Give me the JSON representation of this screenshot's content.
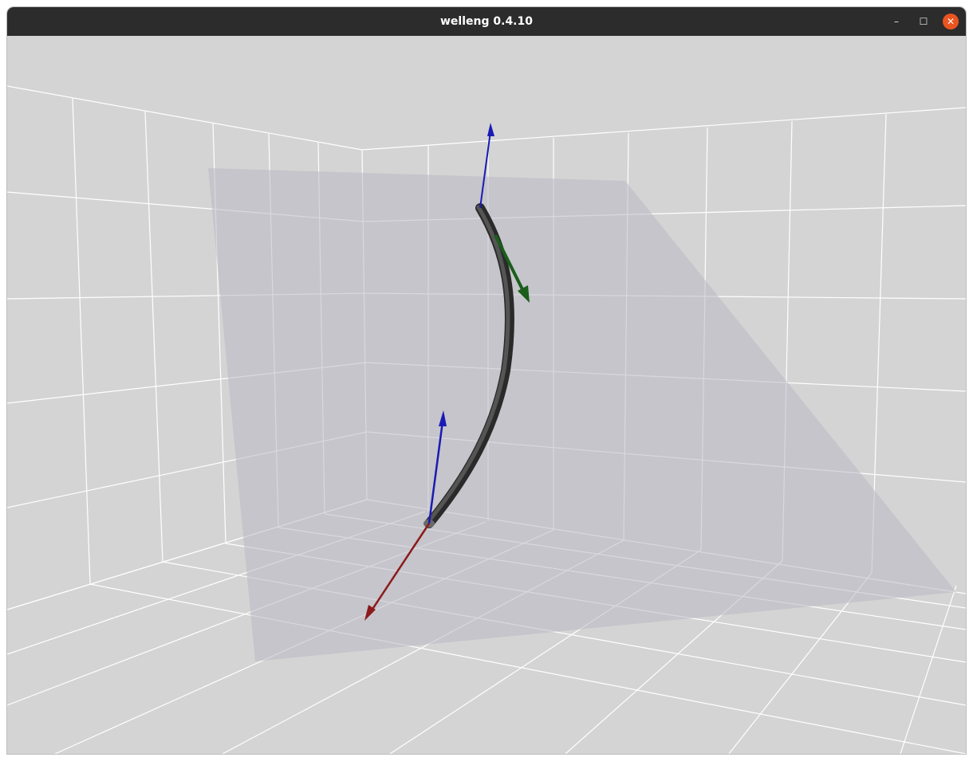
{
  "window": {
    "title": "welleng 0.4.10",
    "minimize_glyph": "–",
    "maximize_glyph": "☐",
    "close_glyph": "✕"
  },
  "icons": {
    "minimize": "minimize-icon",
    "maximize": "maximize-icon",
    "close": "close-icon"
  },
  "colors": {
    "titlebar": "#2c2c2c",
    "background": "#d4d4d4",
    "grid": "#ffffff",
    "plane": "#c2c2c8",
    "wellbore": "#3c3c3c",
    "axis_x": "#8b1a1a",
    "axis_y": "#1a5e1a",
    "axis_z": "#1a1ab4",
    "close_button": "#e95420"
  }
}
